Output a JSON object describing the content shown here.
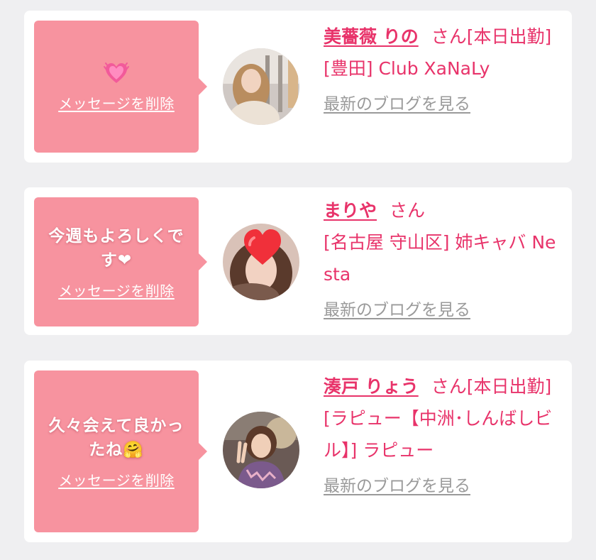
{
  "colors": {
    "page_bg": "#efeff1",
    "card_bg": "#ffffff",
    "bubble_bg": "#f7939f",
    "accent": "#e8336a",
    "link_gray": "#9a9a9a"
  },
  "messages": [
    {
      "message_text": "",
      "message_icon": "sparkling-heart-emoji",
      "delete_label": "メッセージを削除",
      "cast_name": "美薔薇 りの",
      "honorific": "さん",
      "status": "[本日出勤]",
      "shop": "[豊田] Club XaNaLy",
      "blog_label": "最新のブログを見る"
    },
    {
      "message_text": "今週もよろしくです❤",
      "delete_label": "メッセージを削除",
      "cast_name": "まりや",
      "honorific": "さん",
      "status": "",
      "shop": "[名古屋 守山区] 姉キャバ Nesta",
      "blog_label": "最新のブログを見る"
    },
    {
      "message_text": "久々会えて良かったね🤗",
      "delete_label": "メッセージを削除",
      "cast_name": "湊戸 りょう",
      "honorific": "さん",
      "status": "[本日出勤]",
      "shop": "[ラピュー【中洲･しんばしビル】] ラピュー",
      "blog_label": "最新のブログを見る"
    }
  ]
}
